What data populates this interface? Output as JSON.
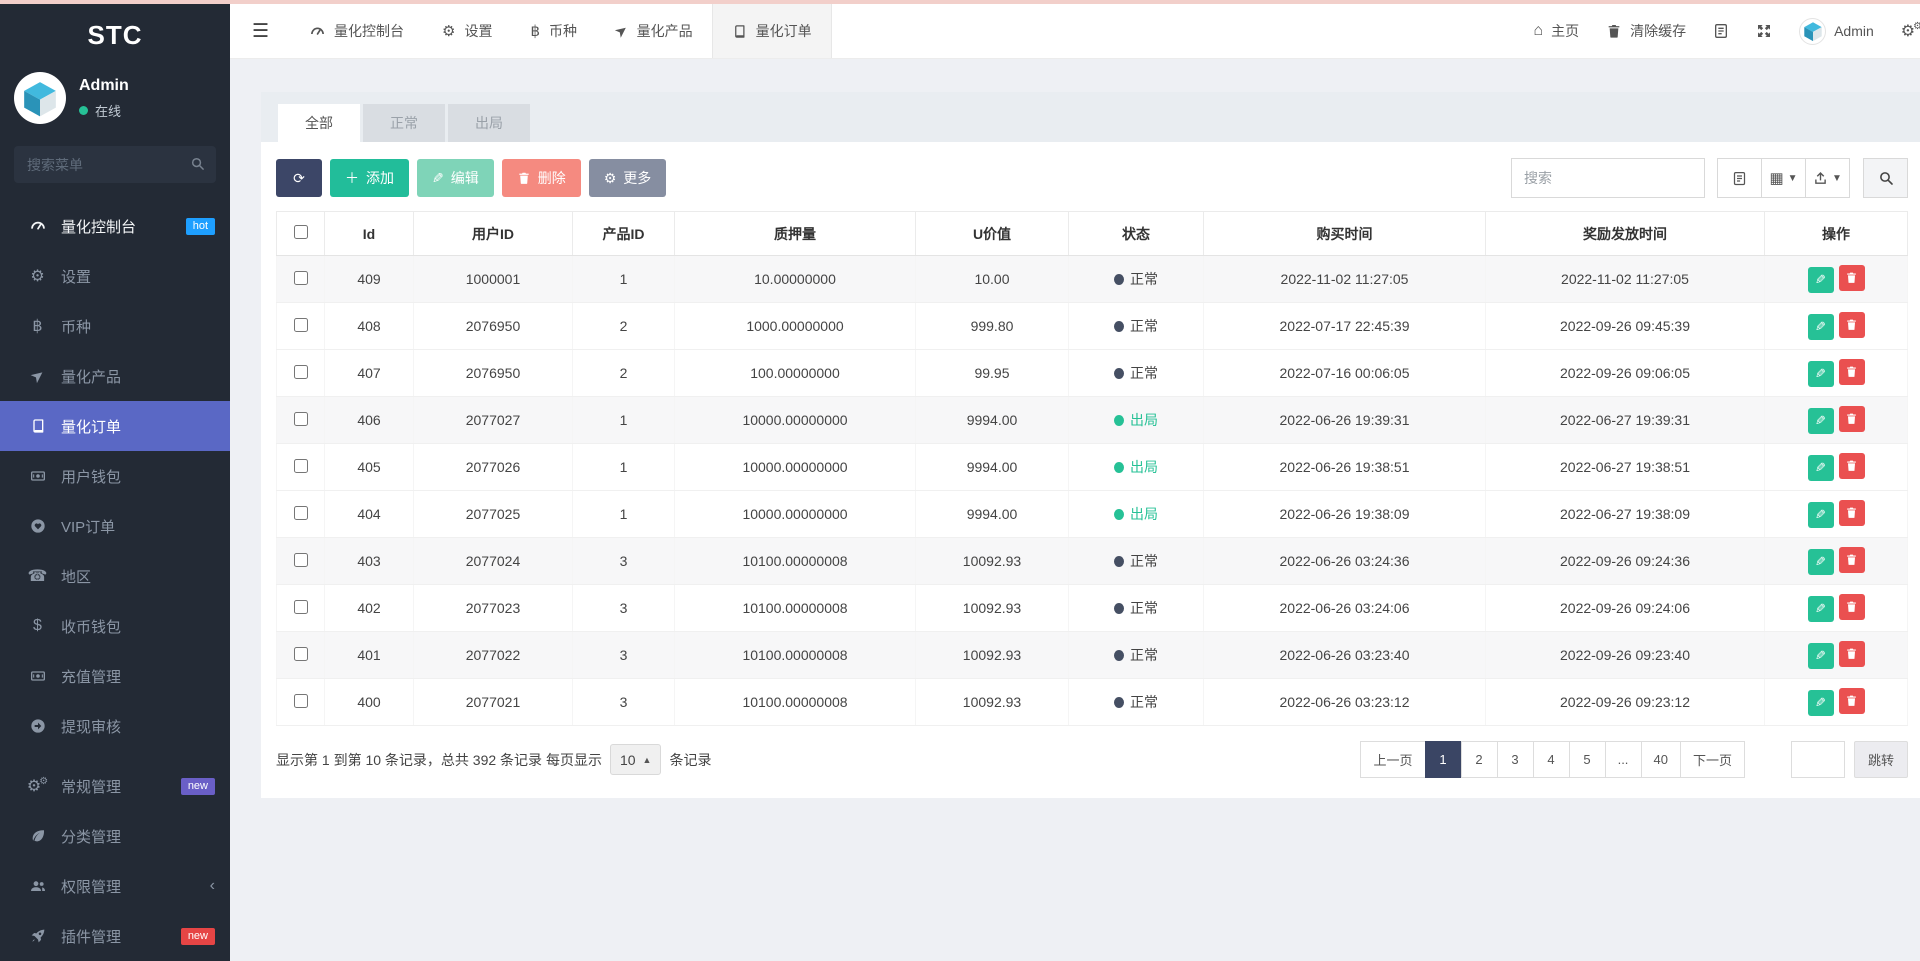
{
  "colors": {
    "accent_green": "#26c196",
    "danger_red": "#ea5050",
    "navy": "#3a4564",
    "sidebar_active": "#5a68c5",
    "hot_badge_blue": "#1e9fff",
    "new_badge_purple": "#6a5fc7",
    "new_badge_red": "#e64545",
    "top_strip_pink": "#f2cfca"
  },
  "sidebar": {
    "brand": "STC",
    "user": {
      "name": "Admin",
      "status": "在线"
    },
    "search_placeholder": "搜索菜单",
    "items": [
      {
        "key": "dashboard",
        "label": "量化控制台",
        "icon": "gauge-icon",
        "bright": true,
        "badge": {
          "text": "hot",
          "color": "#1e9fff"
        }
      },
      {
        "key": "settings",
        "label": "设置",
        "icon": "gear-icon"
      },
      {
        "key": "currency",
        "label": "币种",
        "icon": "bitcoin-icon"
      },
      {
        "key": "products",
        "label": "量化产品",
        "icon": "paper-plane-icon"
      },
      {
        "key": "orders",
        "label": "量化订单",
        "icon": "book-icon",
        "active": true
      },
      {
        "key": "user-wallet",
        "label": "用户钱包",
        "icon": "money-icon"
      },
      {
        "key": "vip-orders",
        "label": "VIP订单",
        "icon": "heart-icon"
      },
      {
        "key": "region",
        "label": "地区",
        "icon": "phone-icon"
      },
      {
        "key": "coin-wallet",
        "label": "收币钱包",
        "icon": "dollar-icon"
      },
      {
        "key": "recharge",
        "label": "充值管理",
        "icon": "money-icon"
      },
      {
        "key": "withdraw-audit",
        "label": "提现审核",
        "icon": "arrow-circle-right-icon"
      },
      {
        "key": "general",
        "label": "常规管理",
        "icon": "cogs-icon",
        "section": true,
        "badge": {
          "text": "new",
          "color": "#6a5fc7"
        }
      },
      {
        "key": "category",
        "label": "分类管理",
        "icon": "leaf-icon"
      },
      {
        "key": "permission",
        "label": "权限管理",
        "icon": "users-icon",
        "chevron": true
      },
      {
        "key": "plugin",
        "label": "插件管理",
        "icon": "rocket-icon",
        "badge": {
          "text": "new",
          "color": "#e64545"
        }
      }
    ]
  },
  "topbar": {
    "tabs": [
      {
        "key": "dashboard",
        "label": "量化控制台",
        "icon": "gauge-icon"
      },
      {
        "key": "settings",
        "label": "设置",
        "icon": "gear-icon"
      },
      {
        "key": "currency",
        "label": "币种",
        "icon": "bitcoin-icon"
      },
      {
        "key": "products",
        "label": "量化产品",
        "icon": "paper-plane-icon"
      },
      {
        "key": "orders",
        "label": "量化订单",
        "icon": "book-icon",
        "active": true
      }
    ],
    "home_label": "主页",
    "clear_cache_label": "清除缓存",
    "user_name": "Admin"
  },
  "panel": {
    "filter_tabs": [
      {
        "label": "全部",
        "active": true
      },
      {
        "label": "正常",
        "active": false
      },
      {
        "label": "出局",
        "active": false
      }
    ],
    "toolbar": {
      "add_label": "添加",
      "edit_label": "编辑",
      "delete_label": "删除",
      "more_label": "更多",
      "search_placeholder": "搜索"
    }
  },
  "table": {
    "columns": [
      "Id",
      "用户ID",
      "产品ID",
      "质押量",
      "U价值",
      "状态",
      "购买时间",
      "奖励发放时间",
      "操作"
    ],
    "status_labels": {
      "normal": "正常",
      "out": "出局"
    },
    "rows": [
      {
        "id": "409",
        "user_id": "1000001",
        "product_id": "1",
        "pledge": "10.00000000",
        "u_value": "10.00",
        "status": "正常",
        "status_type": "normal",
        "buy_time": "2022-11-02 11:27:05",
        "reward_time": "2022-11-02 11:27:05",
        "striped": true
      },
      {
        "id": "408",
        "user_id": "2076950",
        "product_id": "2",
        "pledge": "1000.00000000",
        "u_value": "999.80",
        "status": "正常",
        "status_type": "normal",
        "buy_time": "2022-07-17 22:45:39",
        "reward_time": "2022-09-26 09:45:39",
        "striped": false
      },
      {
        "id": "407",
        "user_id": "2076950",
        "product_id": "2",
        "pledge": "100.00000000",
        "u_value": "99.95",
        "status": "正常",
        "status_type": "normal",
        "buy_time": "2022-07-16 00:06:05",
        "reward_time": "2022-09-26 09:06:05",
        "striped": false
      },
      {
        "id": "406",
        "user_id": "2077027",
        "product_id": "1",
        "pledge": "10000.00000000",
        "u_value": "9994.00",
        "status": "出局",
        "status_type": "out",
        "buy_time": "2022-06-26 19:39:31",
        "reward_time": "2022-06-27 19:39:31",
        "striped": true
      },
      {
        "id": "405",
        "user_id": "2077026",
        "product_id": "1",
        "pledge": "10000.00000000",
        "u_value": "9994.00",
        "status": "出局",
        "status_type": "out",
        "buy_time": "2022-06-26 19:38:51",
        "reward_time": "2022-06-27 19:38:51",
        "striped": false
      },
      {
        "id": "404",
        "user_id": "2077025",
        "product_id": "1",
        "pledge": "10000.00000000",
        "u_value": "9994.00",
        "status": "出局",
        "status_type": "out",
        "buy_time": "2022-06-26 19:38:09",
        "reward_time": "2022-06-27 19:38:09",
        "striped": false
      },
      {
        "id": "403",
        "user_id": "2077024",
        "product_id": "3",
        "pledge": "10100.00000008",
        "u_value": "10092.93",
        "status": "正常",
        "status_type": "normal",
        "buy_time": "2022-06-26 03:24:36",
        "reward_time": "2022-09-26 09:24:36",
        "striped": true
      },
      {
        "id": "402",
        "user_id": "2077023",
        "product_id": "3",
        "pledge": "10100.00000008",
        "u_value": "10092.93",
        "status": "正常",
        "status_type": "normal",
        "buy_time": "2022-06-26 03:24:06",
        "reward_time": "2022-09-26 09:24:06",
        "striped": false
      },
      {
        "id": "401",
        "user_id": "2077022",
        "product_id": "3",
        "pledge": "10100.00000008",
        "u_value": "10092.93",
        "status": "正常",
        "status_type": "normal",
        "buy_time": "2022-06-26 03:23:40",
        "reward_time": "2022-09-26 09:23:40",
        "striped": true
      },
      {
        "id": "400",
        "user_id": "2077021",
        "product_id": "3",
        "pledge": "10100.00000008",
        "u_value": "10092.93",
        "status": "正常",
        "status_type": "normal",
        "buy_time": "2022-06-26 03:23:12",
        "reward_time": "2022-09-26 09:23:12",
        "striped": false
      }
    ]
  },
  "footer": {
    "summary_prefix": "显示第 1 到第 10 条记录，总共 392 条记录 每页显示",
    "page_size": "10",
    "summary_suffix": "条记录",
    "pages": [
      {
        "key": "prev",
        "label": "上一页"
      },
      {
        "key": "1",
        "label": "1",
        "active": true
      },
      {
        "key": "2",
        "label": "2"
      },
      {
        "key": "3",
        "label": "3"
      },
      {
        "key": "4",
        "label": "4"
      },
      {
        "key": "5",
        "label": "5"
      },
      {
        "key": "ellipsis",
        "label": "..."
      },
      {
        "key": "40",
        "label": "40"
      },
      {
        "key": "next",
        "label": "下一页"
      }
    ],
    "jump_label": "跳转"
  }
}
